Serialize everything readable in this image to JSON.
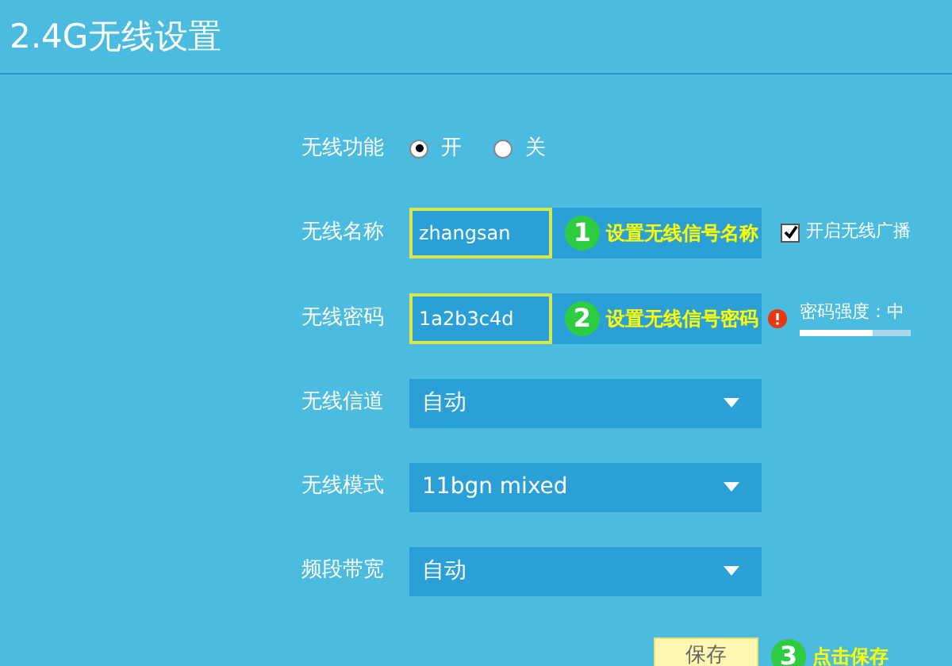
{
  "title": "2.4G无线设置",
  "fields": [
    {
      "kind": "radio",
      "label": "无线功能",
      "options": [
        {
          "label": "开",
          "selected": true
        },
        {
          "label": "关",
          "selected": false
        }
      ]
    },
    {
      "kind": "text",
      "label": "无线名称",
      "value": "zhangsan",
      "step": "1",
      "hint": "设置无线信号名称",
      "checkbox": {
        "label": "开启无线广播",
        "checked": true
      }
    },
    {
      "kind": "text",
      "label": "无线密码",
      "value": "1a2b3c4d",
      "step": "2",
      "hint": "设置无线信号密码",
      "strength": {
        "label": "密码强度：中",
        "level": 0.66
      }
    },
    {
      "kind": "select",
      "label": "无线信道",
      "value": "自动"
    },
    {
      "kind": "select",
      "label": "无线模式",
      "value": "11bgn mixed"
    },
    {
      "kind": "select",
      "label": "频段带宽",
      "value": "自动"
    }
  ],
  "save": {
    "label": "保存",
    "step": "3",
    "hint": "点击保存"
  }
}
